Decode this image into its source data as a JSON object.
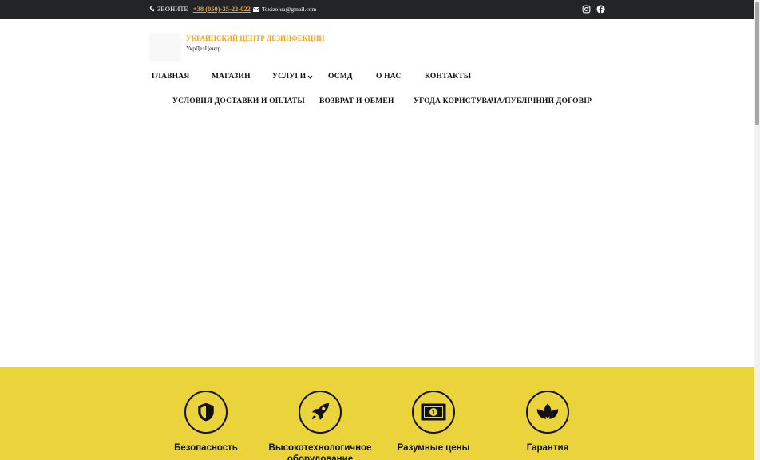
{
  "topbar": {
    "phone_label": "ЗВОНИТЕ",
    "phone_number": "+38 (050)-35-22-022",
    "email": "Texizolua@gmail.com"
  },
  "header": {
    "title": "УКРАИНСКИЙ ЦЕНТР ДЕЗИНФЕКЦИИ",
    "subtitle": "УкрДезЦентр"
  },
  "nav": {
    "row1": [
      "ГЛАВНАЯ",
      "МАГАЗИН",
      "УСЛУГИ",
      "ОСМД",
      "О НАС",
      "КОНТАКТЫ"
    ],
    "row2": [
      "УСЛОВИЯ ДОСТАВКИ И ОПЛАТЫ",
      "ВОЗВРАТ И ОБМЕН",
      "УГОДА КОРИСТУВАЧА/ПУБЛІЧНИЙ ДОГОВІР"
    ]
  },
  "features": [
    {
      "title": "Безопасность",
      "icon": "shield-icon"
    },
    {
      "title": "Высокотехнологичное оборудование",
      "icon": "rocket-icon"
    },
    {
      "title": "Разумные цены",
      "icon": "money-icon"
    },
    {
      "title": "Гарантия",
      "icon": "lotus-icon"
    }
  ],
  "colors": {
    "topbar_bg": "#222427",
    "accent": "#f0a420",
    "band_bg": "#ebd33b"
  }
}
